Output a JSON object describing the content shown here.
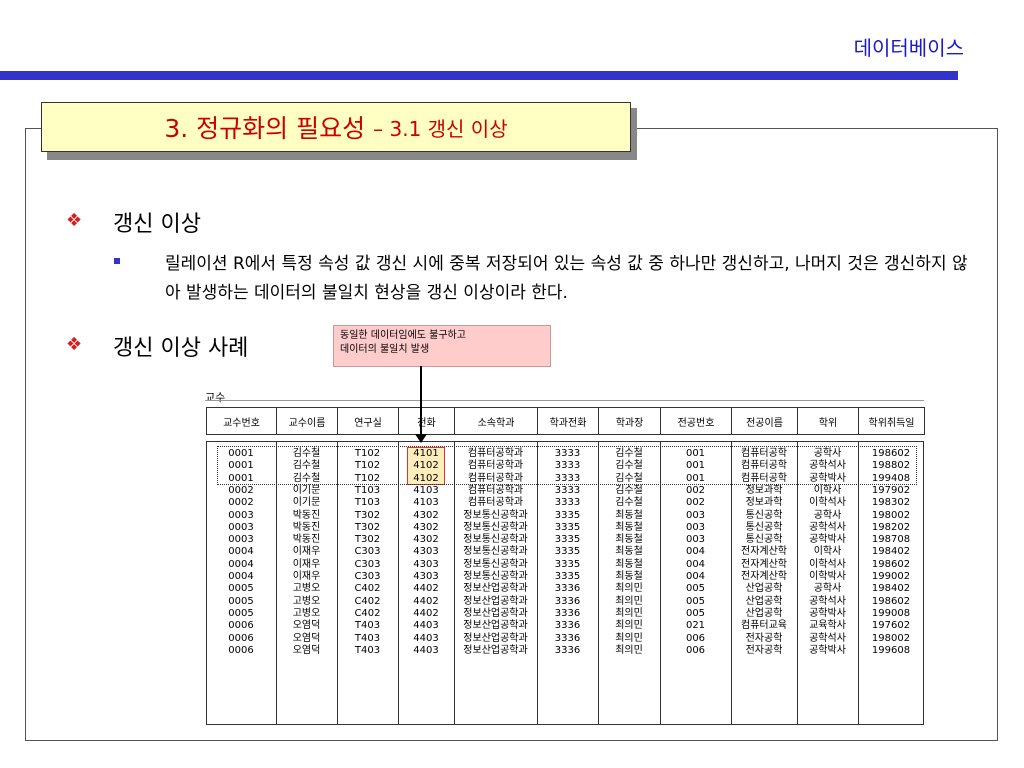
{
  "header": {
    "section": "데이터베이스"
  },
  "title": {
    "main": "3. 정규화의 필요성",
    "sub": "– 3.1 갱신 이상"
  },
  "bullets": {
    "b1": "갱신 이상",
    "b1_para": "릴레이션 R에서 특정 속성 값 갱신 시에 중복 저장되어 있는 속성 값 중 하나만 갱신하고, 나머지 것은 갱신하지 않아 발생하는 데이터의 불일치 현상을 갱신 이상이라 한다.",
    "b2": "갱신 이상 사례"
  },
  "note": {
    "line1": "동일한 데이터임에도 불구하고",
    "line2": "데이터의 불일치 발생"
  },
  "table": {
    "caption": "교수",
    "columns": [
      "교수번호",
      "교수이름",
      "연구실",
      "전화",
      "소속학과",
      "학과전화",
      "학과장",
      "전공번호",
      "전공이름",
      "학위",
      "학위취득일"
    ],
    "rows": [
      [
        "0001",
        "김수철",
        "T102",
        "4101",
        "컴퓨터공학과",
        "3333",
        "김수철",
        "001",
        "컴퓨터공학",
        "공학사",
        "198602"
      ],
      [
        "0001",
        "김수철",
        "T102",
        "4102",
        "컴퓨터공학과",
        "3333",
        "김수철",
        "001",
        "컴퓨터공학",
        "공학석사",
        "198802"
      ],
      [
        "0001",
        "김수철",
        "T102",
        "4102",
        "컴퓨터공학과",
        "3333",
        "김수철",
        "001",
        "컴퓨터공학",
        "공학박사",
        "199408"
      ],
      [
        "0002",
        "이기문",
        "T103",
        "4103",
        "컴퓨터공학과",
        "3333",
        "김수철",
        "002",
        "정보과학",
        "이학사",
        "197902"
      ],
      [
        "0002",
        "이기문",
        "T103",
        "4103",
        "컴퓨터공학과",
        "3333",
        "김수철",
        "002",
        "정보과학",
        "이학석사",
        "198302"
      ],
      [
        "0003",
        "박동진",
        "T302",
        "4302",
        "정보통신공학과",
        "3335",
        "최동철",
        "003",
        "통신공학",
        "공학사",
        "198002"
      ],
      [
        "0003",
        "박동진",
        "T302",
        "4302",
        "정보통신공학과",
        "3335",
        "최동철",
        "003",
        "통신공학",
        "공학석사",
        "198202"
      ],
      [
        "0003",
        "박동진",
        "T302",
        "4302",
        "정보통신공학과",
        "3335",
        "최동철",
        "003",
        "통신공학",
        "공학박사",
        "198708"
      ],
      [
        "0004",
        "이재우",
        "C303",
        "4303",
        "정보통신공학과",
        "3335",
        "최동철",
        "004",
        "전자계산학",
        "이학사",
        "198402"
      ],
      [
        "0004",
        "이재우",
        "C303",
        "4303",
        "정보통신공학과",
        "3335",
        "최동철",
        "004",
        "전자계산학",
        "이학석사",
        "198602"
      ],
      [
        "0004",
        "이재우",
        "C303",
        "4303",
        "정보통신공학과",
        "3335",
        "최동철",
        "004",
        "전자계산학",
        "이학박사",
        "199002"
      ],
      [
        "0005",
        "고병오",
        "C402",
        "4402",
        "정보산업공학과",
        "3336",
        "최의민",
        "005",
        "산업공학",
        "공학사",
        "198402"
      ],
      [
        "0005",
        "고병오",
        "C402",
        "4402",
        "정보산업공학과",
        "3336",
        "최의민",
        "005",
        "산업공학",
        "공학석사",
        "198602"
      ],
      [
        "0005",
        "고병오",
        "C402",
        "4402",
        "정보산업공학과",
        "3336",
        "최의민",
        "005",
        "산업공학",
        "공학박사",
        "199008"
      ],
      [
        "0006",
        "오염덕",
        "T403",
        "4403",
        "정보산업공학과",
        "3336",
        "최의민",
        "021",
        "컴퓨터교육",
        "교육학사",
        "197602"
      ],
      [
        "0006",
        "오염덕",
        "T403",
        "4403",
        "정보산업공학과",
        "3336",
        "최의민",
        "006",
        "전자공학",
        "공학석사",
        "198002"
      ],
      [
        "0006",
        "오염덕",
        "T403",
        "4403",
        "정보산업공학과",
        "3336",
        "최의민",
        "006",
        "전자공학",
        "공학박사",
        "199608"
      ]
    ]
  }
}
